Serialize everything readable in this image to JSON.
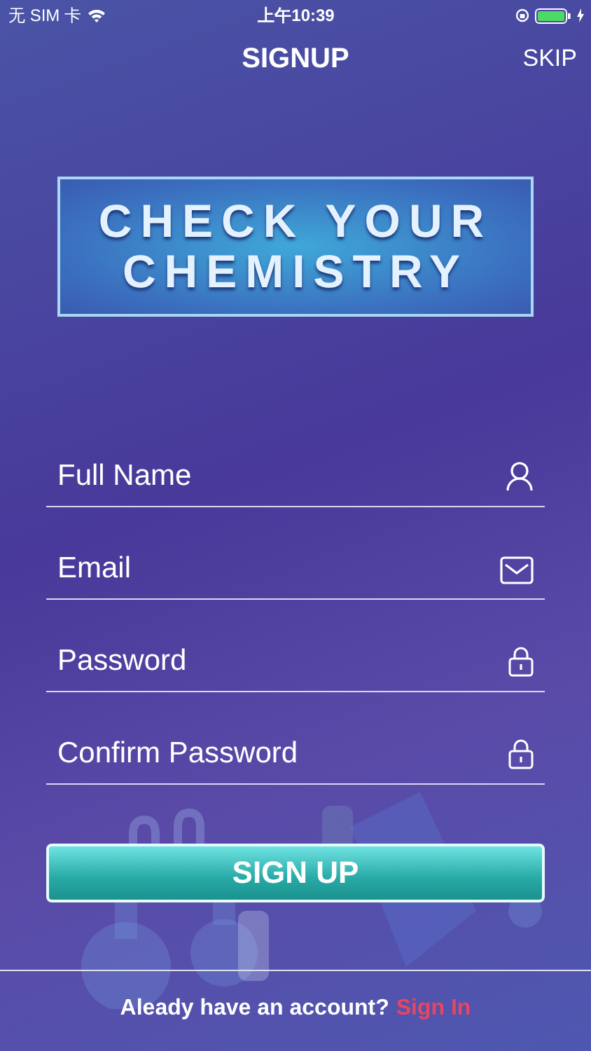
{
  "status_bar": {
    "carrier": "无 SIM 卡",
    "time": "上午10:39"
  },
  "nav": {
    "title": "SIGNUP",
    "skip": "SKIP"
  },
  "logo": {
    "lines": [
      "CHECK YOUR",
      "CHEMISTRY"
    ]
  },
  "fields": [
    {
      "placeholder": "Full Name",
      "kind": "user"
    },
    {
      "placeholder": "Email",
      "kind": "mail"
    },
    {
      "placeholder": "Password",
      "kind": "lock"
    },
    {
      "placeholder": "Confirm Password",
      "kind": "lock"
    }
  ],
  "submit": "SIGN UP",
  "footer": {
    "text": "Aleady have an account?",
    "link": "Sign In"
  }
}
